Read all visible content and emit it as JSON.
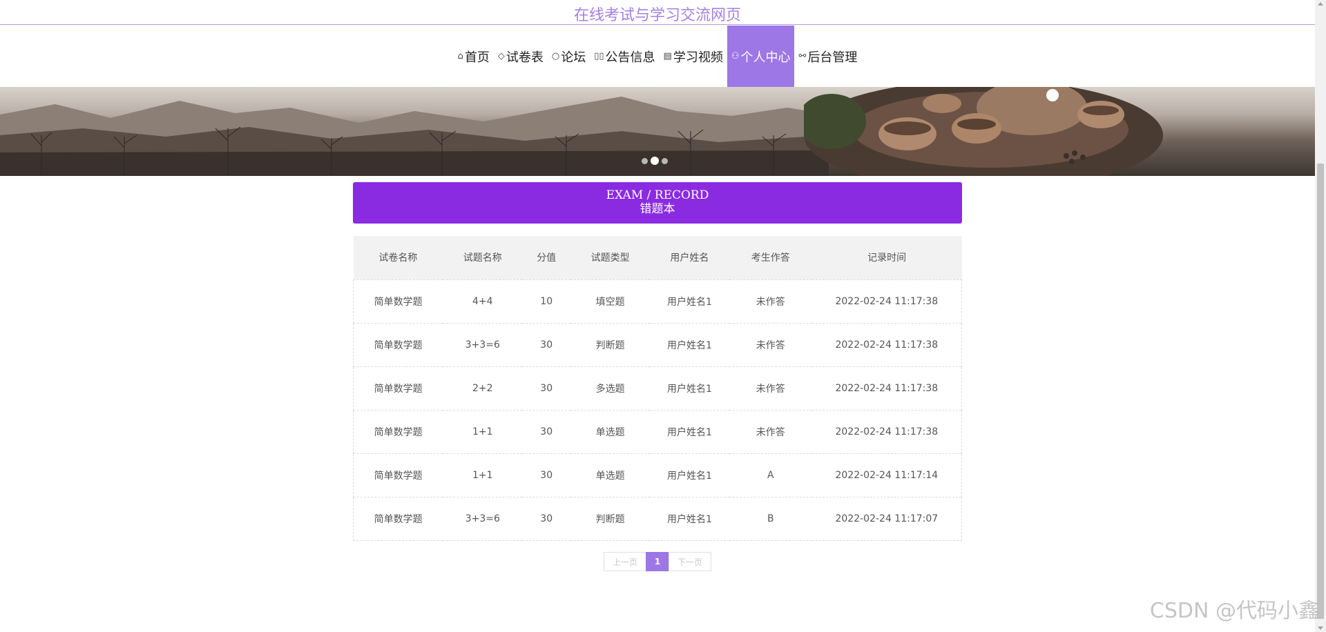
{
  "site": {
    "title": "在线考试与学习交流网页"
  },
  "nav": {
    "items": [
      {
        "label": "首页",
        "icon": "home-icon",
        "glyph": "⌂"
      },
      {
        "label": "试卷表",
        "icon": "tag-icon",
        "glyph": "◇"
      },
      {
        "label": "论坛",
        "icon": "chat-icon",
        "glyph": "○"
      },
      {
        "label": "公告信息",
        "icon": "notice-icon",
        "glyph": "▯▯"
      },
      {
        "label": "学习视频",
        "icon": "calendar-icon",
        "glyph": "▤"
      },
      {
        "label": "个人中心",
        "icon": "user-icon",
        "glyph": "⚇"
      },
      {
        "label": "后台管理",
        "icon": "link-icon",
        "glyph": "⚯"
      }
    ],
    "active_index": 5,
    "active_color": "#9d77e6"
  },
  "banner": {
    "slide_count": 3,
    "active_slide": 2
  },
  "section": {
    "en_title": "EXAM / RECORD",
    "cn_title": "错题本",
    "color": "#8a2be2"
  },
  "table": {
    "headers": [
      "试卷名称",
      "试题名称",
      "分值",
      "试题类型",
      "用户姓名",
      "考生作答",
      "记录时间"
    ],
    "rows": [
      [
        "简单数学题",
        "4+4",
        "10",
        "填空题",
        "用户姓名1",
        "未作答",
        "2022-02-24 11:17:38"
      ],
      [
        "简单数学题",
        "3+3=6",
        "30",
        "判断题",
        "用户姓名1",
        "未作答",
        "2022-02-24 11:17:38"
      ],
      [
        "简单数学题",
        "2+2",
        "30",
        "多选题",
        "用户姓名1",
        "未作答",
        "2022-02-24 11:17:38"
      ],
      [
        "简单数学题",
        "1+1",
        "30",
        "单选题",
        "用户姓名1",
        "未作答",
        "2022-02-24 11:17:38"
      ],
      [
        "简单数学题",
        "1+1",
        "30",
        "单选题",
        "用户姓名1",
        "A",
        "2022-02-24 11:17:14"
      ],
      [
        "简单数学题",
        "3+3=6",
        "30",
        "判断题",
        "用户姓名1",
        "B",
        "2022-02-24 11:17:07"
      ]
    ]
  },
  "pagination": {
    "prev_label": "上一页",
    "current_page": "1",
    "next_label": "下一页"
  },
  "watermark": "CSDN @代码小鑫"
}
